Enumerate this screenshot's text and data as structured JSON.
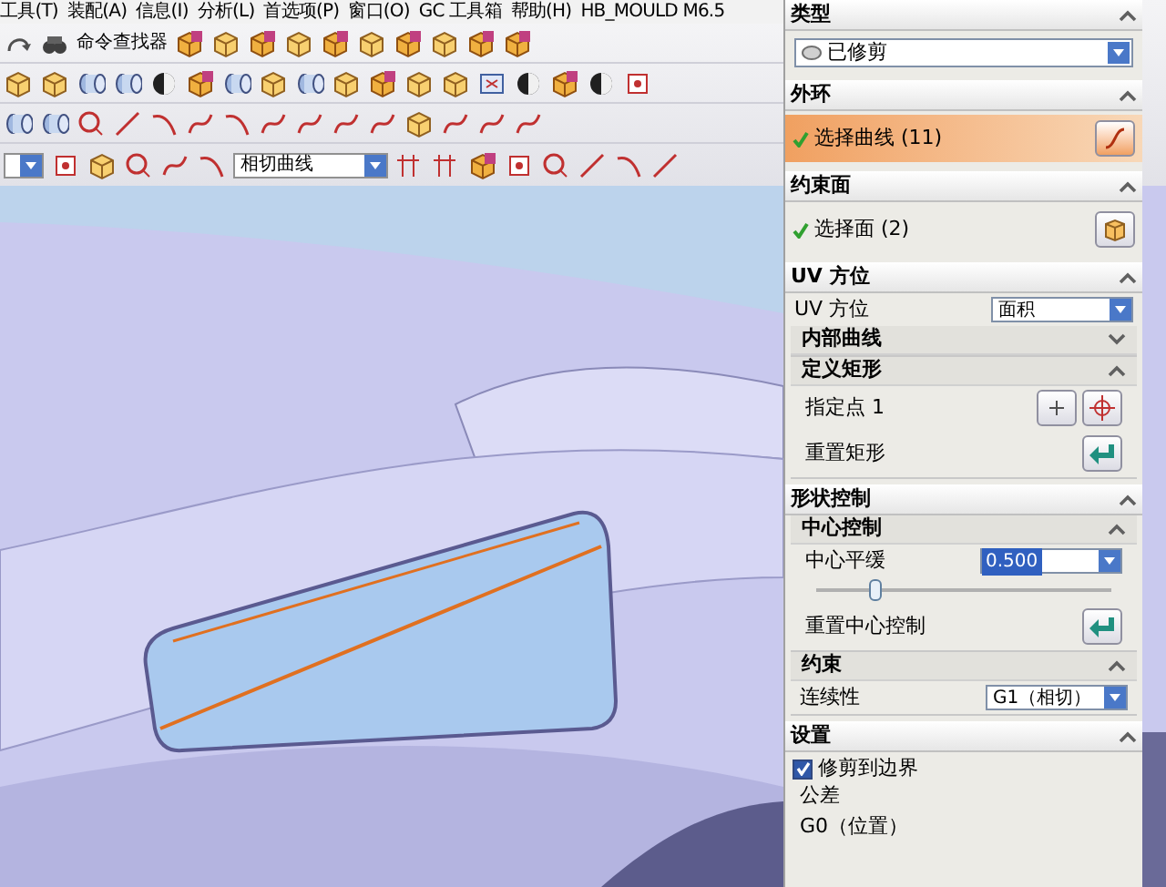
{
  "menu_bar": {
    "items": [
      "工具(T)",
      "装配(A)",
      "信息(I)",
      "分析(L)",
      "首选项(P)",
      "窗口(O)",
      "GC 工具箱",
      "帮助(H)",
      "HB_MOULD M6.5"
    ]
  },
  "toolbar": {
    "command_finder": "命令查找器",
    "filter_dropdown": "相切曲线"
  },
  "panel": {
    "sections": [
      {
        "title": "类型",
        "expanded": true,
        "rows": [
          {
            "kind": "dropdown",
            "value": "已修剪"
          }
        ]
      },
      {
        "title": "外环",
        "expanded": true,
        "rows": [
          {
            "kind": "curve_selection",
            "label": "选择曲线 (11)",
            "selected": true
          }
        ]
      },
      {
        "title": "约束面",
        "expanded": true,
        "rows": [
          {
            "kind": "face_selection",
            "label": "选择面 (2)",
            "selected": false
          }
        ]
      },
      {
        "title": "UV 方位",
        "expanded": true,
        "rows": [
          {
            "kind": "dropdown",
            "label": "UV 方位",
            "value": "面积"
          },
          {
            "kind": "group",
            "title": "内部曲线",
            "expanded": false
          },
          {
            "kind": "group",
            "title": "定义矩形",
            "expanded": true,
            "rows": [
              {
                "kind": "point",
                "label": "指定点 1"
              },
              {
                "kind": "reset",
                "label": "重置矩形"
              }
            ]
          }
        ]
      },
      {
        "title": "形状控制",
        "expanded": true,
        "rows": [
          {
            "kind": "group",
            "title": "中心控制",
            "expanded": true,
            "rows": [
              {
                "kind": "value",
                "label": "中心平缓",
                "value": "0.500",
                "level": 0.2
              },
              {
                "kind": "reset",
                "label": "重置中心控制"
              }
            ]
          },
          {
            "kind": "group",
            "title": "约束",
            "expanded": true,
            "rows": [
              {
                "kind": "dropdown",
                "label": "连续性",
                "value": "G1（相切）"
              }
            ]
          }
        ]
      },
      {
        "title": "设置",
        "expanded": true,
        "rows": [
          {
            "kind": "checkbox",
            "label": "修剪到边界",
            "checked": true
          },
          {
            "kind": "text",
            "label": "公差"
          },
          {
            "kind": "text",
            "label": "G0（位置）"
          }
        ]
      }
    ]
  }
}
